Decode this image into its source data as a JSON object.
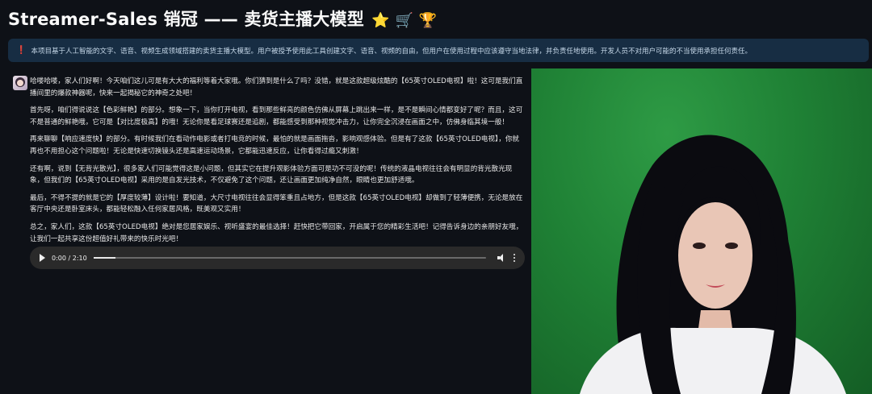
{
  "header": {
    "title": "Streamer-Sales 销冠 —— 卖货主播大模型",
    "title_emojis": "⭐ 🛒 🏆"
  },
  "notice": {
    "icon": "exclamation-icon",
    "text": "本项目基于人工智能的文字、语音、视频生成领域搭建的卖货主播大模型。用户被授予使用此工具创建文字、语音、视频的自由，但用户在使用过程中应该遵守当地法律，并负责任地使用。开发人员不对用户可能的不当使用承担任何责任。"
  },
  "chat": {
    "paragraphs": [
      "哈喽哈喽，家人们好啊！今天咱们这儿可是有大大的福利等着大家哦。你们猜到是什么了吗？没错，就是这款超级炫酷的【65英寸OLED电视】啦！这可是我们直播间里的爆款神器呢，快来一起揭秘它的神奇之处吧！",
      "首先呀，咱们得说说这【色彩鲜艳】的部分。想象一下，当你打开电视，看到那些鲜亮的颜色仿佛从屏幕上跳出来一样，是不是瞬间心情都变好了呢？而且，这可不是普通的鲜艳哦，它可是【对比度极高】的哦！无论你是看足球赛还是追剧，都能感受到那种视觉冲击力，让你完全沉浸在画面之中，仿佛身临其境一般！",
      "再来聊聊【响应速度快】的部分。有时候我们在看动作电影或者打电竞的时候，最怕的就是画面拖沓，影响观感体验。但是有了这款【65英寸OLED电视】，你就再也不用担心这个问题啦！无论是快速切换镜头还是高速运动场景，它都能迅速反应，让你看得过瘾又刺激！",
      "还有啊，说到【无背光散光】，很多家人们可能觉得这是小问题，但其实它在提升观影体验方面可是功不可没的呢！传统的液晶电视往往会有明显的背光散光现象，但我们的【65英寸OLED电视】采用的是自发光技术，不仅避免了这个问题，还让画面更加纯净自然，眼睛也更加舒适哦。",
      "最后，不得不提的就是它的【厚度较薄】设计啦！要知道，大尺寸电视往往会显得笨重且占地方，但是这款【65英寸OLED电视】却做到了轻薄便携，无论是放在客厅中央还是卧室床头，都能轻松融入任何家居风格，既美观又实用！",
      "总之，家人们，这款【65英寸OLED电视】绝对是您居家娱乐、视听盛宴的最佳选择！赶快把它带回家，开启属于您的精彩生活吧！记得告诉身边的亲朋好友哦，让我们一起共享这份超值好礼带来的快乐时光吧！"
    ]
  },
  "audio": {
    "time": "0:00 / 2:10",
    "progress": 0.056,
    "play_icon": "play-icon",
    "volume_icon": "volume-icon",
    "more_icon": "more-options-icon"
  },
  "video": {
    "background_color": "#1f8135"
  }
}
